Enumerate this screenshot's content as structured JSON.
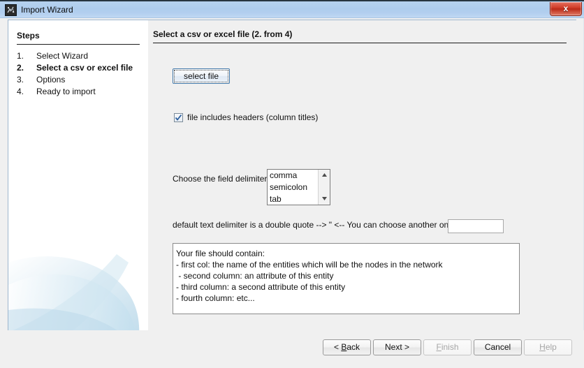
{
  "window": {
    "title": "Import Wizard",
    "icon": "app-icon",
    "close_label": "x"
  },
  "sidebar": {
    "heading": "Steps",
    "steps": [
      {
        "num": "1.",
        "label": "Select Wizard",
        "active": false
      },
      {
        "num": "2.",
        "label": "Select a csv or excel file",
        "active": true
      },
      {
        "num": "3.",
        "label": "Options",
        "active": false
      },
      {
        "num": "4.",
        "label": "Ready to import",
        "active": false
      }
    ]
  },
  "main": {
    "page_title": "Select a csv or excel file (2. from 4)",
    "select_file_button": "select file",
    "headers_checkbox": {
      "label": "file includes headers (column titles)",
      "checked": true
    },
    "delimiter": {
      "label": "Choose the field delimiter:",
      "options": [
        "comma",
        "semicolon",
        "tab"
      ],
      "scroll_up_icon": "triangle-up-icon",
      "scroll_down_icon": "triangle-down-icon"
    },
    "text_delimiter": {
      "label": "default text delimiter is a double quote --> \" <--  You can choose another one:",
      "value": "",
      "placeholder": ""
    },
    "info_box": {
      "lines": [
        "Your file should contain:",
        "- first col: the name of the entities which will be the nodes in the network",
        " - second column: an attribute of this entity",
        "- third column: a second attribute of this entity",
        "- fourth column: etc..."
      ]
    }
  },
  "footer": {
    "buttons": [
      {
        "id": "back",
        "pre": "< ",
        "accel": "B",
        "post": "ack",
        "disabled": false
      },
      {
        "id": "next",
        "pre": "",
        "accel": "N",
        "post": "ext >",
        "disabled": false
      },
      {
        "id": "finish",
        "pre": "",
        "accel": "F",
        "post": "inish",
        "disabled": true
      },
      {
        "id": "cancel",
        "pre": "",
        "accel": "C",
        "post": "ancel",
        "disabled": false
      },
      {
        "id": "help",
        "pre": "",
        "accel": "H",
        "post": "elp",
        "disabled": true
      }
    ]
  },
  "colors": {
    "titlebar": "#aecced",
    "close_button": "#d2402c",
    "accent_border": "#3f76a8",
    "sidebar_bg": "#ffffff",
    "content_bg": "#f0f0f0",
    "deco": "#bcd8ea"
  }
}
